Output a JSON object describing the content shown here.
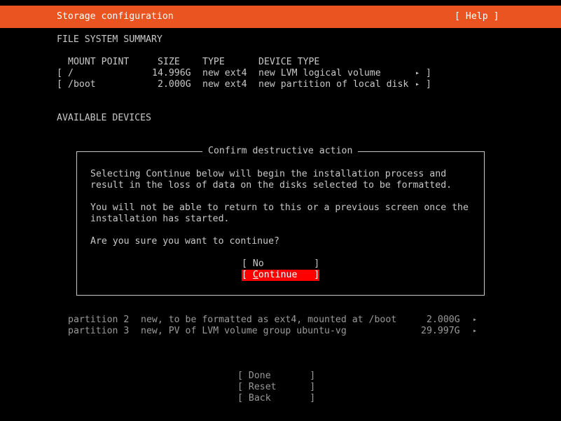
{
  "header": {
    "title": "Storage configuration",
    "help_label": "[ Help ]",
    "color": "#e95420"
  },
  "summary": {
    "heading": "FILE SYSTEM SUMMARY",
    "columns": [
      "MOUNT POINT",
      "SIZE",
      "TYPE",
      "DEVICE TYPE"
    ],
    "rows": [
      {
        "bracket_open": "[",
        "mount": "/",
        "size": "14.996G",
        "type": "new ext4",
        "device_type": "new LVM logical volume",
        "arrow": "▸",
        "bracket_close": "]"
      },
      {
        "bracket_open": "[",
        "mount": "/boot",
        "size": "2.000G",
        "type": "new ext4",
        "device_type": "new partition of local disk",
        "arrow": "▸",
        "bracket_close": "]"
      }
    ]
  },
  "available_devices": {
    "heading": "AVAILABLE DEVICES",
    "partitions": [
      {
        "name": "partition 2",
        "desc": "new, to be formatted as ext4, mounted at /boot",
        "size": "2.000G",
        "arrow": "▸"
      },
      {
        "name": "partition 3",
        "desc": "new, PV of LVM volume group ubuntu-vg",
        "size": "29.997G",
        "arrow": "▸"
      }
    ]
  },
  "dialog": {
    "title": "Confirm destructive action",
    "lines": [
      "Selecting Continue below will begin the installation process and",
      "result in the loss of data on the disks selected to be formatted.",
      "You will not be able to return to this or a previous screen once the",
      "installation has started.",
      "Are you sure you want to continue?"
    ],
    "buttons": {
      "no": {
        "open": "[ ",
        "label": "No",
        "close": "         ]"
      },
      "continue": {
        "open": "[ ",
        "accel": "C",
        "rest": "ontinue",
        "close": "   ]"
      }
    },
    "selected_color": "#ff0000"
  },
  "footer": {
    "done": "[ Done       ]",
    "reset": "[ Reset      ]",
    "back": "[ Back       ]"
  }
}
